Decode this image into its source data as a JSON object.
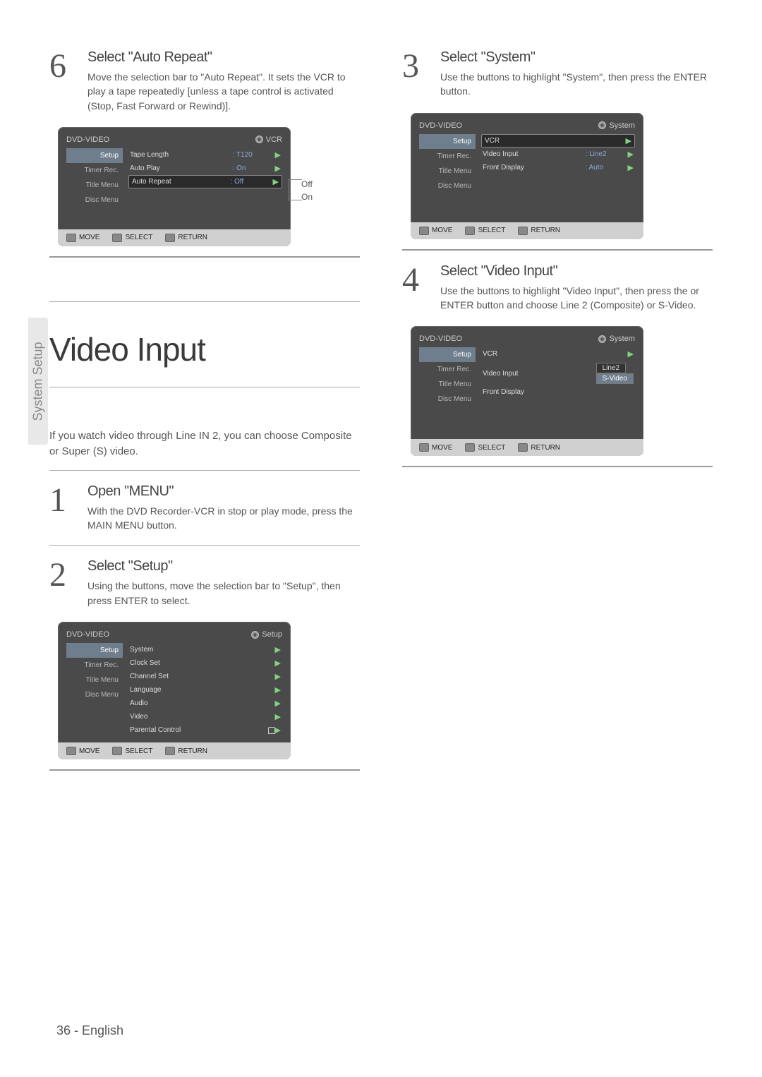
{
  "vtab": "System Setup",
  "col1": {
    "step6": {
      "num": "6",
      "title": "Select \"Auto Repeat\"",
      "desc": "Move the selection bar to \"Auto Repeat\". It sets the VCR to play a tape repeatedly [unless a tape control is activated (Stop, Fast Forward or Rewind)]."
    },
    "osd1": {
      "device": "DVD-VIDEO",
      "tag": "VCR",
      "side": [
        "Setup",
        "Timer Rec.",
        "Title Menu",
        "Disc Menu"
      ],
      "rows": [
        {
          "label": "Tape Length",
          "val": ": T120"
        },
        {
          "label": "Auto Play",
          "val": ": On"
        },
        {
          "label": "Auto Repeat",
          "val": ": Off",
          "sel": true
        }
      ],
      "callout": [
        "Off",
        "On"
      ],
      "foot": [
        "MOVE",
        "SELECT",
        "RETURN"
      ]
    },
    "bigtitle": "Video Input",
    "intro": "If you watch video through Line IN 2, you can choose Composite or Super (S) video.",
    "step1": {
      "num": "1",
      "title": "Open \"MENU\"",
      "desc": "With the DVD Recorder-VCR in stop or play mode, press the MAIN MENU button."
    },
    "step2": {
      "num": "2",
      "title": "Select \"Setup\"",
      "desc": "Using the            buttons, move the selection bar to \"Setup\", then press ENTER to select."
    },
    "osd2": {
      "device": "DVD-VIDEO",
      "tag": "Setup",
      "side": [
        "Setup",
        "Timer Rec.",
        "Title Menu",
        "Disc Menu"
      ],
      "rows": [
        {
          "label": "System"
        },
        {
          "label": "Clock Set"
        },
        {
          "label": "Channel Set"
        },
        {
          "label": "Language"
        },
        {
          "label": "Audio"
        },
        {
          "label": "Video"
        },
        {
          "label": "Parental Control",
          "lock": true
        }
      ],
      "foot": [
        "MOVE",
        "SELECT",
        "RETURN"
      ]
    }
  },
  "col2": {
    "step3": {
      "num": "3",
      "title": "Select \"System\"",
      "desc": "Use the            buttons to highlight \"System\", then press the ENTER button."
    },
    "osd3": {
      "device": "DVD-VIDEO",
      "tag": "System",
      "side": [
        "Setup",
        "Timer Rec.",
        "Title Menu",
        "Disc Menu"
      ],
      "rows": [
        {
          "label": "VCR",
          "sel": true
        },
        {
          "label": "Video Input",
          "val": ": Line2"
        },
        {
          "label": "Front Display",
          "val": ": Auto"
        }
      ],
      "foot": [
        "MOVE",
        "SELECT",
        "RETURN"
      ]
    },
    "step4": {
      "num": "4",
      "title": "Select \"Video Input\"",
      "desc": "Use the            buttons to highlight \"Video Input\", then press the        or ENTER button and choose Line 2 (Composite) or S-Video."
    },
    "osd4": {
      "device": "DVD-VIDEO",
      "tag": "System",
      "side": [
        "Setup",
        "Timer Rec.",
        "Title Menu",
        "Disc Menu"
      ],
      "rows": [
        {
          "label": "VCR"
        },
        {
          "label": "Video Input",
          "opts": [
            "Line2",
            "S-Video"
          ]
        },
        {
          "label": "Front Display"
        }
      ],
      "foot": [
        "MOVE",
        "SELECT",
        "RETURN"
      ]
    }
  },
  "footer": "36 - English"
}
